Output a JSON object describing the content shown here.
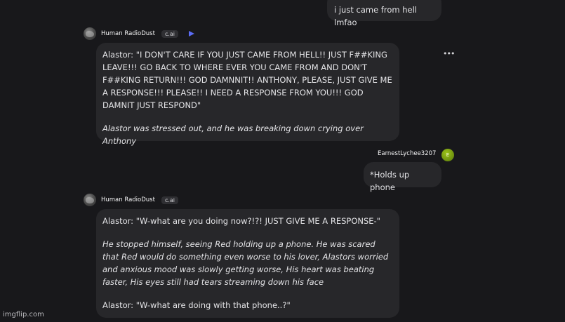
{
  "messages": [
    {
      "sender": "user",
      "text": "i just came from hell lmfao"
    },
    {
      "sender": "bot",
      "name": "Human RadioDust",
      "badge": "c.ai",
      "paragraphs": [
        "Alastor: \"I DON'T CARE IF YOU JUST CAME FROM HELL!! JUST F##KING LEAVE!!! GO BACK TO WHERE EVER YOU CAME FROM AND DON'T F##KING RETURN!!! GOD DAMNNIT!! ANTHONY, PLEASE, JUST GIVE ME A RESPONSE!!! PLEASE!! I NEED A RESPONSE FROM YOU!!! GOD DAMNIT JUST RESPOND\"",
        "Alastor was stressed out, and he was breaking down crying over Anthony"
      ]
    },
    {
      "sender": "user",
      "name": "EarnestLychee3207",
      "avatar_letter": "E",
      "text": "*Holds up phone"
    },
    {
      "sender": "bot",
      "name": "Human RadioDust",
      "badge": "c.ai",
      "paragraphs": [
        "Alastor: \"W-what are you doing now?!?! JUST GIVE ME A RESPONSE-\"",
        "He stopped himself, seeing Red holding up a phone. He was scared that Red would do something even worse to his lover, Alastors worried and anxious mood was slowly getting worse, His heart was beating faster, His eyes still had tears streaming down his face",
        "Alastor: \"W-what are doing with that phone..?\""
      ]
    }
  ],
  "more_icon": "more-horizontal-icon",
  "play_icon": "play-icon",
  "watermark": "imgflip.com",
  "colors": {
    "background": "#18181b",
    "bubble": "#27272a",
    "play_accent": "#5b6cf5",
    "user_avatar": "#8db31a"
  }
}
